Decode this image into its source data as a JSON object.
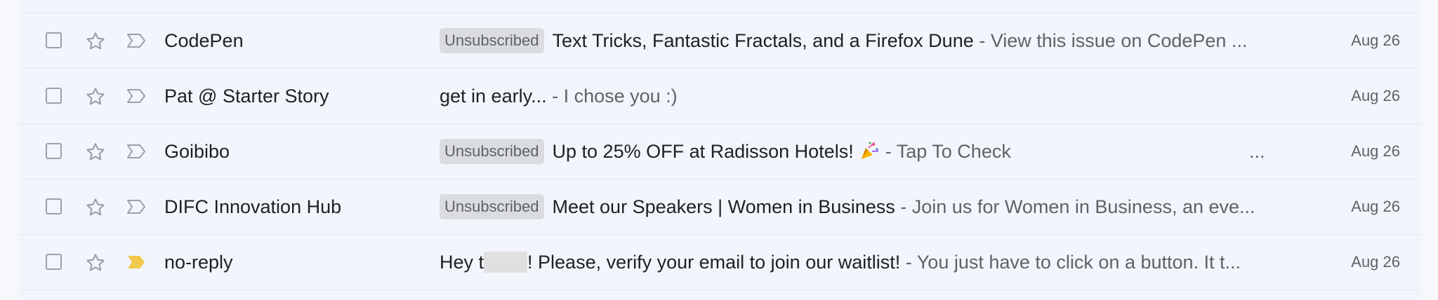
{
  "colors": {
    "row_background": "#f2f6fc",
    "badge_background": "#dadce0",
    "important_marker_active": "#f2c94c",
    "icon_outline": "#9aa0a6"
  },
  "emails": [
    {
      "sender": "CodePen",
      "badge": "Unsubscribed",
      "subject": "Text Tricks, Fantastic Fractals, and a Firefox Dune",
      "snippet": "- View this issue on CodePen ...",
      "date": "Aug 26",
      "important": false
    },
    {
      "sender": "Pat @ Starter Story",
      "badge": "",
      "subject": "get in early...",
      "snippet": "- I chose you :)",
      "date": "Aug 26",
      "important": false
    },
    {
      "sender": "Goibibo",
      "badge": "Unsubscribed",
      "subject": "Up to 25% OFF at Radisson Hotels!",
      "subject_icon": "party-popper-icon",
      "snippet": "- Tap To Check",
      "trailing": "...",
      "date": "Aug 26",
      "important": false
    },
    {
      "sender": "DIFC Innovation Hub",
      "badge": "Unsubscribed",
      "subject": "Meet our Speakers | Women in Business",
      "snippet": "- Join us for Women in Business, an eve...",
      "date": "Aug 26",
      "important": false
    },
    {
      "sender": "no-reply",
      "badge": "",
      "subject_part1": "Hey t",
      "subject_part2": "! Please, verify your email to join our waitlist!",
      "snippet": "- You just have to click on a button. It t...",
      "date": "Aug 26",
      "important": true
    }
  ]
}
